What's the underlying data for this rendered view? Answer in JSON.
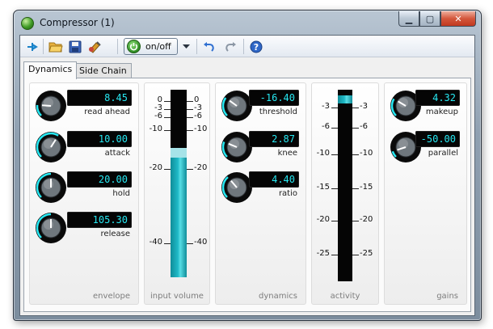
{
  "window": {
    "title": "Compressor (1)"
  },
  "window_buttons": {
    "minimize": "▁",
    "maximize": "▢",
    "close": "✕"
  },
  "toolbar": {
    "onoff_label": "on/off",
    "icons": [
      "pin-icon",
      "open-folder-icon",
      "save-icon",
      "preset-icon",
      "power-icon",
      "dropdown-arrow-icon",
      "undo-icon",
      "redo-icon",
      "help-icon"
    ]
  },
  "tabs": [
    {
      "label": "Dynamics",
      "active": true
    },
    {
      "label": "Side Chain",
      "active": false
    }
  ],
  "panels": {
    "envelope": {
      "title": "envelope",
      "knobs": [
        {
          "label": "read ahead",
          "value": "8.45",
          "level": 0.18
        },
        {
          "label": "attack",
          "value": "10.00",
          "level": 0.62
        },
        {
          "label": "hold",
          "value": "20.00",
          "level": 0.5
        },
        {
          "label": "release",
          "value": "105.30",
          "level": 0.5
        }
      ]
    },
    "input_volume": {
      "title": "input volume",
      "scale_labels": [
        "0",
        "-3",
        "-6",
        "-10",
        "-20",
        "-40"
      ],
      "scale_values": [
        0,
        -3,
        -6,
        -10,
        -20,
        -40
      ],
      "level_db": -17
    },
    "dynamics": {
      "title": "dynamics",
      "knobs": [
        {
          "label": "threshold",
          "value": "-16.40",
          "level": 0.3
        },
        {
          "label": "knee",
          "value": "2.87",
          "level": 0.25
        },
        {
          "label": "ratio",
          "value": "4.40",
          "level": 0.35
        }
      ]
    },
    "activity": {
      "title": "activity",
      "scale_labels": [
        "-3",
        "-6",
        "-10",
        "-15",
        "-20",
        "-25"
      ],
      "scale_values": [
        -3,
        -6,
        -10,
        -15,
        -20,
        -25
      ],
      "level_db": -1
    },
    "gains": {
      "title": "gains",
      "knobs": [
        {
          "label": "makeup",
          "value": "4.32",
          "level": 0.28
        },
        {
          "label": "parallel",
          "value": "-50.00",
          "level": 0.1
        }
      ]
    }
  },
  "colors": {
    "lcd_text": "#27e8f2",
    "meter_fill": "#1fb9c6",
    "accent_arc": "#27e8f2",
    "power_green": "#2e8c22",
    "close_red": "#c1391f"
  }
}
